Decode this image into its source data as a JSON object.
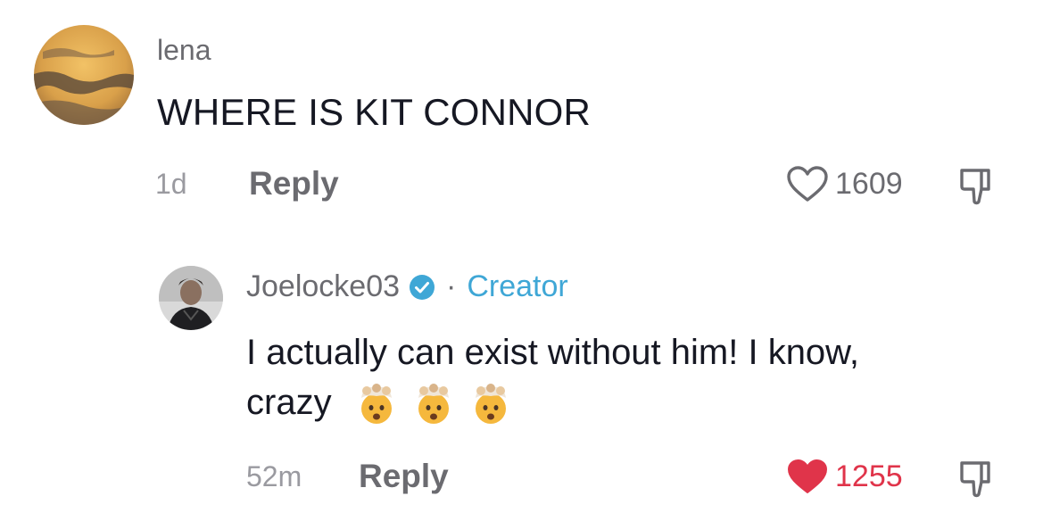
{
  "comments": [
    {
      "username": "lena",
      "text": "WHERE IS KIT CONNOR",
      "time": "1d",
      "reply_label": "Reply",
      "likes": "1609",
      "liked": false,
      "avatar_icon": "sunset-sky-avatar"
    },
    {
      "username": "Joelocke03",
      "verified": true,
      "separator": "·",
      "badge": "Creator",
      "text_line1": "I actually can exist without him! I know,",
      "text_line2": "crazy",
      "emoji_icon": "exploding-head-emoji",
      "time": "52m",
      "reply_label": "Reply",
      "likes": "1255",
      "liked": true,
      "avatar_icon": "person-avatar"
    }
  ],
  "colors": {
    "username": "#6b6b70",
    "text": "#161823",
    "liked_heart": "#e0344a",
    "creator_badge": "#3fa7d6",
    "verified_badge": "#3fa7d6"
  }
}
